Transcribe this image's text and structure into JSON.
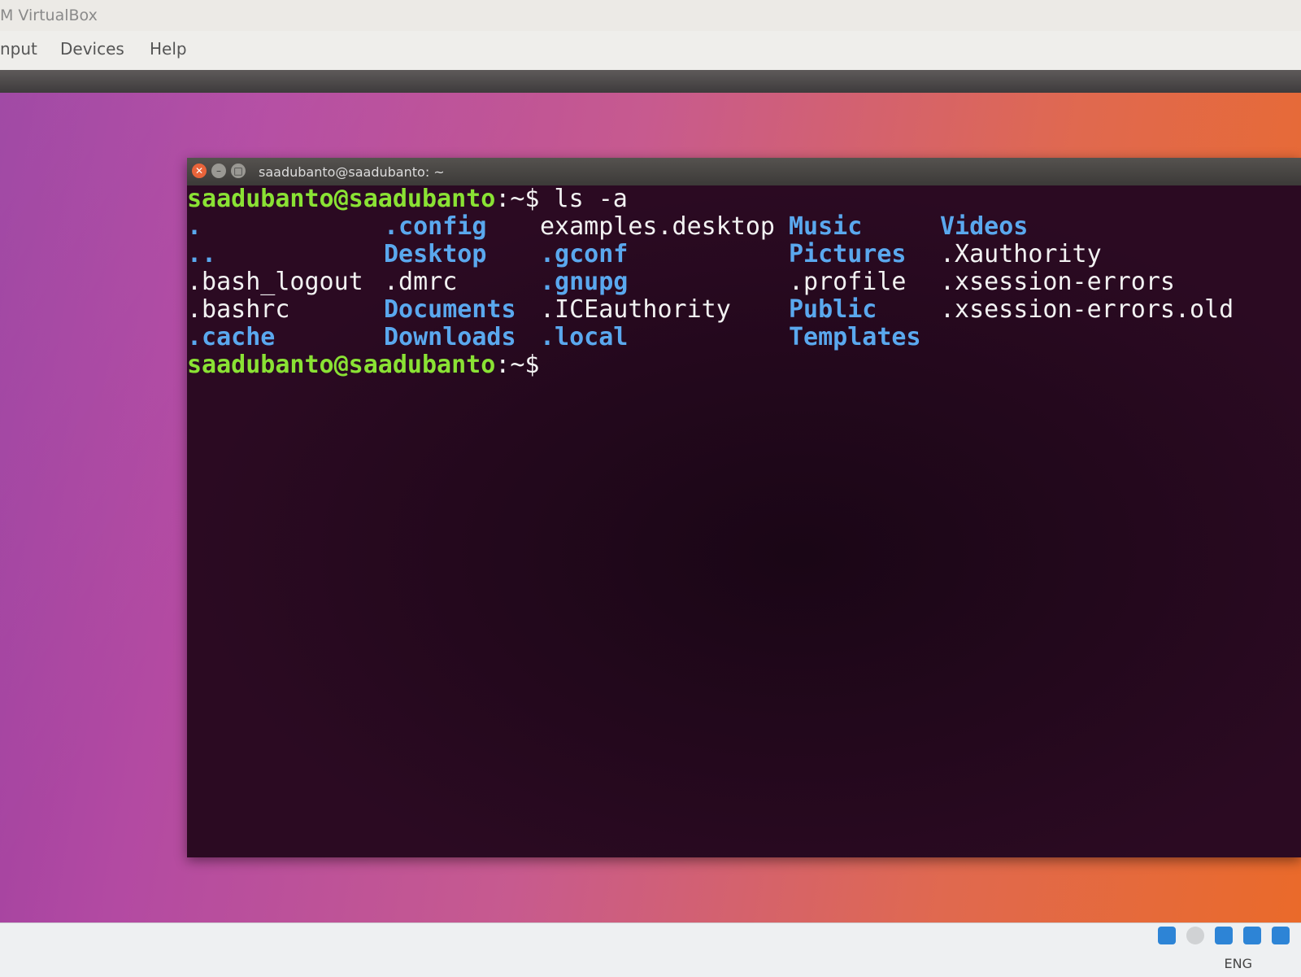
{
  "host": {
    "window_title": "M VirtualBox",
    "menu": [
      "nput",
      "Devices",
      "Help"
    ],
    "language": "ENG"
  },
  "terminal": {
    "title": "saadubanto@saadubanto: ~",
    "prompt_user": "saadubanto@saadubanto",
    "prompt_suffix": ":~$",
    "command": " ls -a",
    "columns": [
      [
        {
          "name": ".",
          "type": "dir"
        },
        {
          "name": "..",
          "type": "dir"
        },
        {
          "name": ".bash_logout",
          "type": "file"
        },
        {
          "name": ".bashrc",
          "type": "file"
        },
        {
          "name": ".cache",
          "type": "dir"
        }
      ],
      [
        {
          "name": ".config",
          "type": "dir"
        },
        {
          "name": "Desktop",
          "type": "dir"
        },
        {
          "name": ".dmrc",
          "type": "file"
        },
        {
          "name": "Documents",
          "type": "dir"
        },
        {
          "name": "Downloads",
          "type": "dir"
        }
      ],
      [
        {
          "name": "examples.desktop",
          "type": "file"
        },
        {
          "name": ".gconf",
          "type": "dir"
        },
        {
          "name": ".gnupg",
          "type": "dir"
        },
        {
          "name": ".ICEauthority",
          "type": "file"
        },
        {
          "name": ".local",
          "type": "dir"
        }
      ],
      [
        {
          "name": "Music",
          "type": "dir"
        },
        {
          "name": "Pictures",
          "type": "dir"
        },
        {
          "name": ".profile",
          "type": "file"
        },
        {
          "name": "Public",
          "type": "dir"
        },
        {
          "name": "Templates",
          "type": "dir"
        }
      ],
      [
        {
          "name": "Videos",
          "type": "dir"
        },
        {
          "name": ".Xauthority",
          "type": "file"
        },
        {
          "name": ".xsession-errors",
          "type": "file"
        },
        {
          "name": ".xsession-errors.old",
          "type": "file"
        }
      ]
    ]
  },
  "colors": {
    "prompt": "#8ae234",
    "directory": "#5aa8ee",
    "file": "#f2f2f2",
    "terminal_bg": "#2b0a22"
  }
}
